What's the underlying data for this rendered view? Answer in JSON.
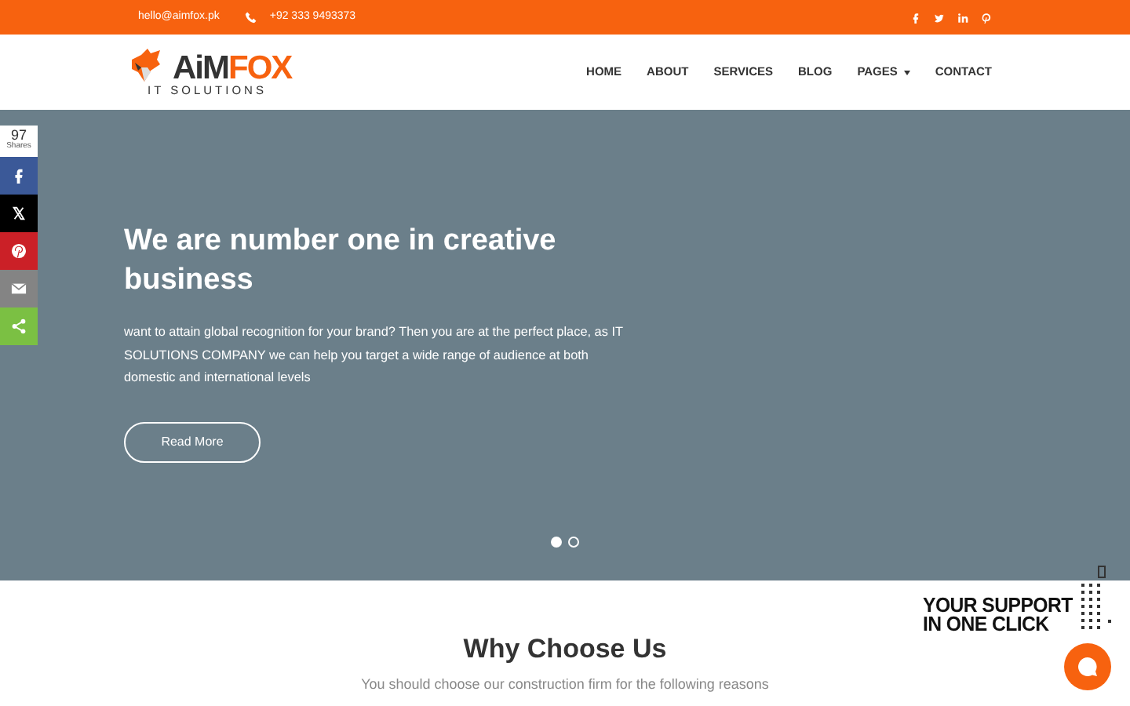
{
  "top_bar": {
    "email": "hello@aimfox.pk",
    "phone": "+92 333 9493373",
    "social": [
      {
        "kind": "facebook"
      },
      {
        "kind": "twitter"
      },
      {
        "kind": "linkedin"
      },
      {
        "kind": "pinterest"
      }
    ]
  },
  "logo": {
    "word_dark": "AiM",
    "word_accent": "FOX",
    "tagline": "IT SOLUTIONS"
  },
  "nav": [
    {
      "label": "HOME",
      "dropdown": false
    },
    {
      "label": "ABOUT",
      "dropdown": false
    },
    {
      "label": "SERVICES",
      "dropdown": false
    },
    {
      "label": "BLOG",
      "dropdown": false
    },
    {
      "label": "PAGES",
      "dropdown": true
    },
    {
      "label": "CONTACT",
      "dropdown": false
    }
  ],
  "share_bar": {
    "count": "97",
    "count_label": "Shares",
    "buttons": [
      {
        "kind": "facebook",
        "color": "#3b5998"
      },
      {
        "kind": "x",
        "color": "#000000"
      },
      {
        "kind": "pinterest",
        "color": "#cb2027"
      },
      {
        "kind": "email",
        "color": "#848484"
      },
      {
        "kind": "share",
        "color": "#7bc043"
      }
    ]
  },
  "hero": {
    "title": "We are number one in creative business",
    "text": "want to attain global recognition for your brand? Then you are at the perfect place, as IT SOLUTIONS COMPANY we can help you target a wide range of audience at both domestic and international levels",
    "button": "Read More",
    "slides": [
      {
        "selected": true
      },
      {
        "selected": false
      }
    ]
  },
  "why": {
    "title": "Why Choose Us",
    "subtitle": "You should choose our construction firm for the following reasons"
  },
  "support_banner": {
    "line_1": "YOUR SUPPORT",
    "line_2": "IN ONE CLICK"
  }
}
